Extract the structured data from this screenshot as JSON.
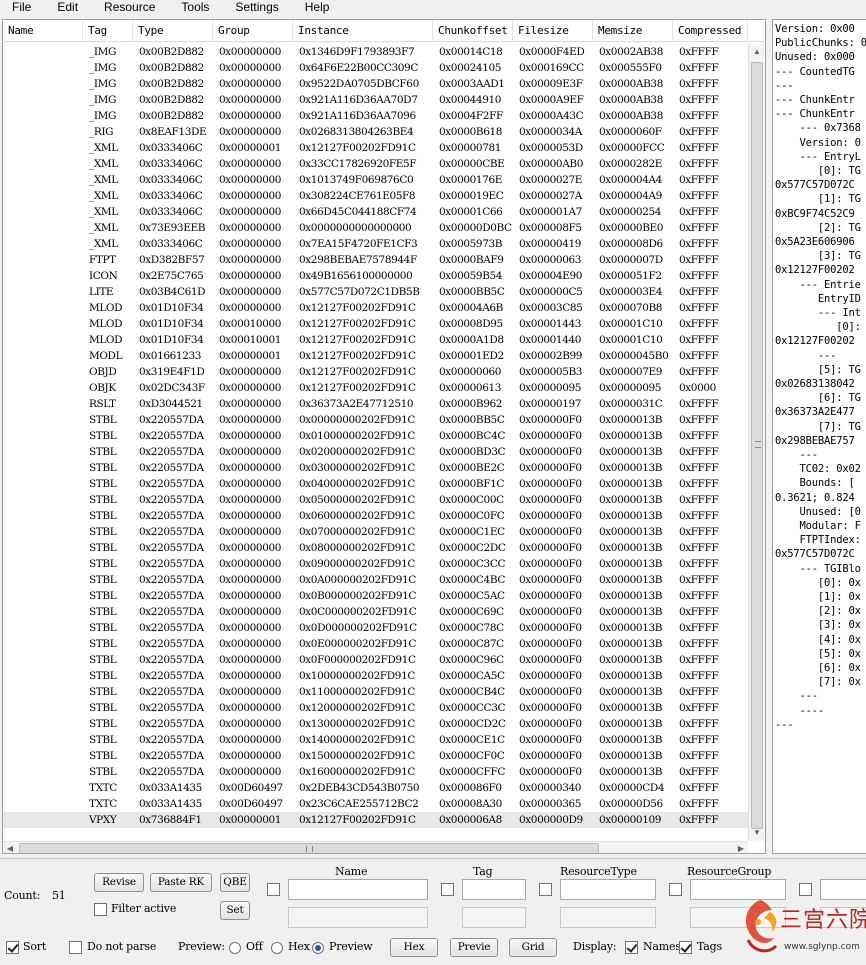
{
  "menu": [
    "File",
    "Edit",
    "Resource",
    "Tools",
    "Settings",
    "Help"
  ],
  "columns": [
    "Name",
    "Tag",
    "Type",
    "Group",
    "Instance",
    "Chunkoffset",
    "Filesize",
    "Memsize",
    "Compressed"
  ],
  "rows": [
    [
      "",
      "_IMG",
      "0x00B2D882",
      "0x00000000",
      "0x1346D9F1793893F7",
      "0x00014C18",
      "0x0000F4ED",
      "0x0002AB38",
      "0xFFFF"
    ],
    [
      "",
      "_IMG",
      "0x00B2D882",
      "0x00000000",
      "0x64F6E22B00CC309C",
      "0x00024105",
      "0x000169CC",
      "0x000555F0",
      "0xFFFF"
    ],
    [
      "",
      "_IMG",
      "0x00B2D882",
      "0x00000000",
      "0x9522DA0705DBCF60",
      "0x0003AAD1",
      "0x00009E3F",
      "0x0000AB38",
      "0xFFFF"
    ],
    [
      "",
      "_IMG",
      "0x00B2D882",
      "0x00000000",
      "0x921A116D36AA70D7",
      "0x00044910",
      "0x0000A9EF",
      "0x0000AB38",
      "0xFFFF"
    ],
    [
      "",
      "_IMG",
      "0x00B2D882",
      "0x00000000",
      "0x921A116D36AA7096",
      "0x0004F2FF",
      "0x0000A43C",
      "0x0000AB38",
      "0xFFFF"
    ],
    [
      "",
      "_RIG",
      "0x8EAF13DE",
      "0x00000000",
      "0x0268313804263BE4",
      "0x0000B618",
      "0x0000034A",
      "0x0000060F",
      "0xFFFF"
    ],
    [
      "",
      "_XML",
      "0x0333406C",
      "0x00000001",
      "0x12127F00202FD91C",
      "0x00000781",
      "0x0000053D",
      "0x00000FCC",
      "0xFFFF"
    ],
    [
      "",
      "_XML",
      "0x0333406C",
      "0x00000000",
      "0x33CC17826920FE5F",
      "0x00000CBE",
      "0x00000AB0",
      "0x0000282E",
      "0xFFFF"
    ],
    [
      "",
      "_XML",
      "0x0333406C",
      "0x00000000",
      "0x1013749F069876C0",
      "0x0000176E",
      "0x0000027E",
      "0x000004A4",
      "0xFFFF"
    ],
    [
      "",
      "_XML",
      "0x0333406C",
      "0x00000000",
      "0x308224CE761E05F8",
      "0x000019EC",
      "0x0000027A",
      "0x000004A9",
      "0xFFFF"
    ],
    [
      "",
      "_XML",
      "0x0333406C",
      "0x00000000",
      "0x66D45C044188CF74",
      "0x00001C66",
      "0x000001A7",
      "0x00000254",
      "0xFFFF"
    ],
    [
      "",
      "_XML",
      "0x73E93EEB",
      "0x00000000",
      "0x0000000000000000",
      "0x00000D0BC",
      "0x000008F5",
      "0x00000BE0",
      "0xFFFF"
    ],
    [
      "",
      "_XML",
      "0x0333406C",
      "0x00000000",
      "0x7EA15F4720FE1CF3",
      "0x0005973B",
      "0x00000419",
      "0x000008D6",
      "0xFFFF"
    ],
    [
      "",
      "FTPT",
      "0xD382BF57",
      "0x00000000",
      "0x298BEBAE7578944F",
      "0x0000BAF9",
      "0x00000063",
      "0x0000007D",
      "0xFFFF"
    ],
    [
      "",
      "ICON",
      "0x2E75C765",
      "0x00000000",
      "0x49B1656100000000",
      "0x00059B54",
      "0x00004E90",
      "0x000051F2",
      "0xFFFF"
    ],
    [
      "",
      "LITE",
      "0x03B4C61D",
      "0x00000000",
      "0x577C57D072C1DB5B",
      "0x0000BB5C",
      "0x000000C5",
      "0x000003E4",
      "0xFFFF"
    ],
    [
      "",
      "MLOD",
      "0x01D10F34",
      "0x00000000",
      "0x12127F00202FD91C",
      "0x00004A6B",
      "0x00003C85",
      "0x000070B8",
      "0xFFFF"
    ],
    [
      "",
      "MLOD",
      "0x01D10F34",
      "0x00010000",
      "0x12127F00202FD91C",
      "0x00008D95",
      "0x00001443",
      "0x00001C10",
      "0xFFFF"
    ],
    [
      "",
      "MLOD",
      "0x01D10F34",
      "0x00010001",
      "0x12127F00202FD91C",
      "0x0000A1D8",
      "0x00001440",
      "0x00001C10",
      "0xFFFF"
    ],
    [
      "",
      "MODL",
      "0x01661233",
      "0x00000001",
      "0x12127F00202FD91C",
      "0x00001ED2",
      "0x00002B99",
      "0x0000045B0",
      "0xFFFF"
    ],
    [
      "",
      "OBJD",
      "0x319E4F1D",
      "0x00000000",
      "0x12127F00202FD91C",
      "0x00000060",
      "0x000005B3",
      "0x000007E9",
      "0xFFFF"
    ],
    [
      "",
      "OBJK",
      "0x02DC343F",
      "0x00000000",
      "0x12127F00202FD91C",
      "0x00000613",
      "0x00000095",
      "0x00000095",
      "0x0000"
    ],
    [
      "",
      "RSLT",
      "0xD3044521",
      "0x00000000",
      "0x36373A2E47712510",
      "0x0000B962",
      "0x00000197",
      "0x0000031C",
      "0xFFFF"
    ],
    [
      "",
      "STBL",
      "0x220557DA",
      "0x00000000",
      "0x00000000202FD91C",
      "0x0000BB5C",
      "0x000000F0",
      "0x0000013B",
      "0xFFFF"
    ],
    [
      "",
      "STBL",
      "0x220557DA",
      "0x00000000",
      "0x01000000202FD91C",
      "0x0000BC4C",
      "0x000000F0",
      "0x0000013B",
      "0xFFFF"
    ],
    [
      "",
      "STBL",
      "0x220557DA",
      "0x00000000",
      "0x02000000202FD91C",
      "0x0000BD3C",
      "0x000000F0",
      "0x0000013B",
      "0xFFFF"
    ],
    [
      "",
      "STBL",
      "0x220557DA",
      "0x00000000",
      "0x03000000202FD91C",
      "0x0000BE2C",
      "0x000000F0",
      "0x0000013B",
      "0xFFFF"
    ],
    [
      "",
      "STBL",
      "0x220557DA",
      "0x00000000",
      "0x04000000202FD91C",
      "0x0000BF1C",
      "0x000000F0",
      "0x0000013B",
      "0xFFFF"
    ],
    [
      "",
      "STBL",
      "0x220557DA",
      "0x00000000",
      "0x05000000202FD91C",
      "0x0000C00C",
      "0x000000F0",
      "0x0000013B",
      "0xFFFF"
    ],
    [
      "",
      "STBL",
      "0x220557DA",
      "0x00000000",
      "0x06000000202FD91C",
      "0x0000C0FC",
      "0x000000F0",
      "0x0000013B",
      "0xFFFF"
    ],
    [
      "",
      "STBL",
      "0x220557DA",
      "0x00000000",
      "0x07000000202FD91C",
      "0x0000C1EC",
      "0x000000F0",
      "0x0000013B",
      "0xFFFF"
    ],
    [
      "",
      "STBL",
      "0x220557DA",
      "0x00000000",
      "0x08000000202FD91C",
      "0x0000C2DC",
      "0x000000F0",
      "0x0000013B",
      "0xFFFF"
    ],
    [
      "",
      "STBL",
      "0x220557DA",
      "0x00000000",
      "0x09000000202FD91C",
      "0x0000C3CC",
      "0x000000F0",
      "0x0000013B",
      "0xFFFF"
    ],
    [
      "",
      "STBL",
      "0x220557DA",
      "0x00000000",
      "0x0A000000202FD91C",
      "0x0000C4BC",
      "0x000000F0",
      "0x0000013B",
      "0xFFFF"
    ],
    [
      "",
      "STBL",
      "0x220557DA",
      "0x00000000",
      "0x0B000000202FD91C",
      "0x0000C5AC",
      "0x000000F0",
      "0x0000013B",
      "0xFFFF"
    ],
    [
      "",
      "STBL",
      "0x220557DA",
      "0x00000000",
      "0x0C000000202FD91C",
      "0x0000C69C",
      "0x000000F0",
      "0x0000013B",
      "0xFFFF"
    ],
    [
      "",
      "STBL",
      "0x220557DA",
      "0x00000000",
      "0x0D000000202FD91C",
      "0x0000C78C",
      "0x000000F0",
      "0x0000013B",
      "0xFFFF"
    ],
    [
      "",
      "STBL",
      "0x220557DA",
      "0x00000000",
      "0x0E000000202FD91C",
      "0x0000C87C",
      "0x000000F0",
      "0x0000013B",
      "0xFFFF"
    ],
    [
      "",
      "STBL",
      "0x220557DA",
      "0x00000000",
      "0x0F000000202FD91C",
      "0x0000C96C",
      "0x000000F0",
      "0x0000013B",
      "0xFFFF"
    ],
    [
      "",
      "STBL",
      "0x220557DA",
      "0x00000000",
      "0x10000000202FD91C",
      "0x0000CA5C",
      "0x000000F0",
      "0x0000013B",
      "0xFFFF"
    ],
    [
      "",
      "STBL",
      "0x220557DA",
      "0x00000000",
      "0x11000000202FD91C",
      "0x0000CB4C",
      "0x000000F0",
      "0x0000013B",
      "0xFFFF"
    ],
    [
      "",
      "STBL",
      "0x220557DA",
      "0x00000000",
      "0x12000000202FD91C",
      "0x0000CC3C",
      "0x000000F0",
      "0x0000013B",
      "0xFFFF"
    ],
    [
      "",
      "STBL",
      "0x220557DA",
      "0x00000000",
      "0x13000000202FD91C",
      "0x0000CD2C",
      "0x000000F0",
      "0x0000013B",
      "0xFFFF"
    ],
    [
      "",
      "STBL",
      "0x220557DA",
      "0x00000000",
      "0x14000000202FD91C",
      "0x0000CE1C",
      "0x000000F0",
      "0x0000013B",
      "0xFFFF"
    ],
    [
      "",
      "STBL",
      "0x220557DA",
      "0x00000000",
      "0x15000000202FD91C",
      "0x0000CF0C",
      "0x000000F0",
      "0x0000013B",
      "0xFFFF"
    ],
    [
      "",
      "STBL",
      "0x220557DA",
      "0x00000000",
      "0x16000000202FD91C",
      "0x0000CFFC",
      "0x000000F0",
      "0x0000013B",
      "0xFFFF"
    ],
    [
      "",
      "TXTC",
      "0x033A1435",
      "0x00D60497",
      "0x2DEB43CD543B0750",
      "0x000086F0",
      "0x00000340",
      "0x00000CD4",
      "0xFFFF"
    ],
    [
      "",
      "TXTC",
      "0x033A1435",
      "0x00D60497",
      "0x23C6CAE255712BC2",
      "0x00008A30",
      "0x00000365",
      "0x00000D56",
      "0xFFFF"
    ],
    [
      "",
      "VPXY",
      "0x736884F1",
      "0x00000001",
      "0x12127F00202FD91C",
      "0x000006A8",
      "0x000000D9",
      "0x00000109",
      "0xFFFF"
    ]
  ],
  "details": [
    "Version: 0x00",
    "PublicChunks: 0",
    "Unused: 0x000",
    "--- CountedTG",
    "---",
    "--- ChunkEntr",
    "--- ChunkEntr",
    "    --- 0x7368",
    "    Version: 0",
    "    --- EntryL",
    "       [0]: TG",
    "0x577C57D072C",
    "       [1]: TG",
    "0xBC9F74C52C9",
    "       [2]: TG",
    "0x5A23E606906",
    "       [3]: TG",
    "0x12127F00202",
    "    --- Entrie",
    "       EntryID",
    "       --- Int",
    "          [0]:",
    "0x12127F00202",
    "       ---",
    "       [5]: TG",
    "0x02683138042",
    "       [6]: TG",
    "0x36373A2E477",
    "       [7]: TG",
    "0x298BEBAE757",
    "    ---",
    "    TC02: 0x02",
    "    Bounds: [",
    "0.3621; 0.824",
    "    Unused: [0",
    "    Modular: F",
    "    FTPTIndex:",
    "0x577C57D072C",
    "    --- TGIBlo",
    "       [0]: 0x",
    "       [1]: 0x",
    "       [2]: 0x",
    "       [3]: 0x",
    "       [4]: 0x",
    "       [5]: 0x",
    "       [6]: 0x",
    "       [7]: 0x",
    "    ---",
    "    ----",
    "---"
  ],
  "bottom": {
    "count_label": "Count:",
    "count_value": "51",
    "revise_label": "Revise",
    "paste_rk_label": "Paste RK",
    "qbe_label": "QBE",
    "set_label": "Set",
    "filter_active_label": "Filter active",
    "filter_headers": [
      "Name",
      "Tag",
      "ResourceType",
      "ResourceGroup"
    ],
    "sort_label": "Sort",
    "do_not_parse_label": "Do not parse",
    "preview_label": "Preview:",
    "off_label": "Off",
    "hex_label": "Hex",
    "preview_radio_label": "Preview",
    "hex_button_label": "Hex",
    "preview_button_label": "Previe",
    "grid_button_label": "Grid",
    "display_label": "Display:",
    "names_label": "Names",
    "tags_label": "Tags"
  },
  "watermark": {
    "text": "三宫六院",
    "url": "www.sglynp.com"
  }
}
